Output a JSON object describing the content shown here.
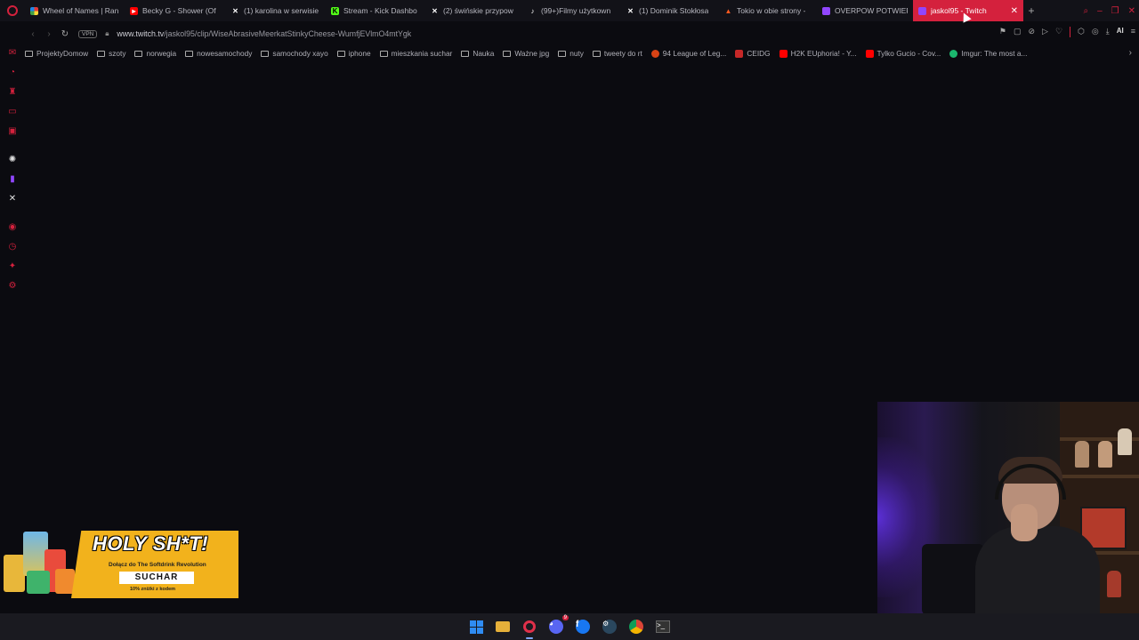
{
  "tabs": [
    {
      "title": "Wheel of Names | Ran",
      "favicon_color": "#4caf50",
      "favicon": "wheel-icon"
    },
    {
      "title": "Becky G - Shower (Of",
      "favicon_color": "#ff0000",
      "favicon": "youtube-icon"
    },
    {
      "title": "(1) karolina w serwisie",
      "favicon_color": "#ffffff",
      "favicon": "x-icon"
    },
    {
      "title": "Stream - Kick Dashbo",
      "favicon_color": "#53fc18",
      "favicon": "kick-icon"
    },
    {
      "title": "(2) świńskie przypow",
      "favicon_color": "#ffffff",
      "favicon": "x-icon"
    },
    {
      "title": "(99+)Filmy użytkown",
      "favicon_color": "#ffffff",
      "favicon": "tiktok-icon"
    },
    {
      "title": "(1) Dominik Stokłosa",
      "favicon_color": "#ffffff",
      "favicon": "x-icon"
    },
    {
      "title": "Tokio w obie strony -",
      "favicon_color": "#ff5a1f",
      "favicon": "fire-icon"
    },
    {
      "title": "OVERPOW POTWIERD",
      "favicon_color": "#9146ff",
      "favicon": "twitch-icon"
    },
    {
      "title": "jaskol95 - Twitch",
      "favicon_color": "#9146ff",
      "favicon": "twitch-icon",
      "active": true
    }
  ],
  "address": {
    "vpn_label": "VPN",
    "url_host": "www.twitch.tv",
    "url_path": "/jaskol95/clip/WiseAbrasiveMeerkatStinkyCheese-WumfjEVlmO4mtYgk"
  },
  "address_icons": {
    "ai_label": "AI"
  },
  "bookmarks": [
    {
      "label": "ProjektyDomow",
      "type": "folder"
    },
    {
      "label": "szoty",
      "type": "folder"
    },
    {
      "label": "norwegia",
      "type": "folder"
    },
    {
      "label": "nowesamochody",
      "type": "folder"
    },
    {
      "label": "samochody xayo",
      "type": "folder"
    },
    {
      "label": "iphone",
      "type": "folder"
    },
    {
      "label": "mieszkania suchar",
      "type": "folder"
    },
    {
      "label": "Nauka",
      "type": "folder"
    },
    {
      "label": "Ważne jpg",
      "type": "folder"
    },
    {
      "label": "nuty",
      "type": "folder"
    },
    {
      "label": "tweety do rt",
      "type": "folder"
    },
    {
      "label": "94 League of Leg...",
      "type": "link",
      "color": "#d84315"
    },
    {
      "label": "CEIDG",
      "type": "link",
      "color": "#c62828"
    },
    {
      "label": "H2K EUphoria! - Y...",
      "type": "link",
      "color": "#ff0000"
    },
    {
      "label": "Tylko Gucio - Cov...",
      "type": "link",
      "color": "#ff0000"
    },
    {
      "label": "Imgur: The most a...",
      "type": "link",
      "color": "#1bb76e"
    }
  ],
  "ad": {
    "headline": "HOLY SH*T!",
    "subline": "Dołącz do The Softdrink Revolution",
    "code": "SUCHAR",
    "footnote": "10% zniżki z kodem"
  },
  "colors": {
    "accent": "#d4213d",
    "twitch": "#9146ff",
    "background": "#0b0b10"
  }
}
